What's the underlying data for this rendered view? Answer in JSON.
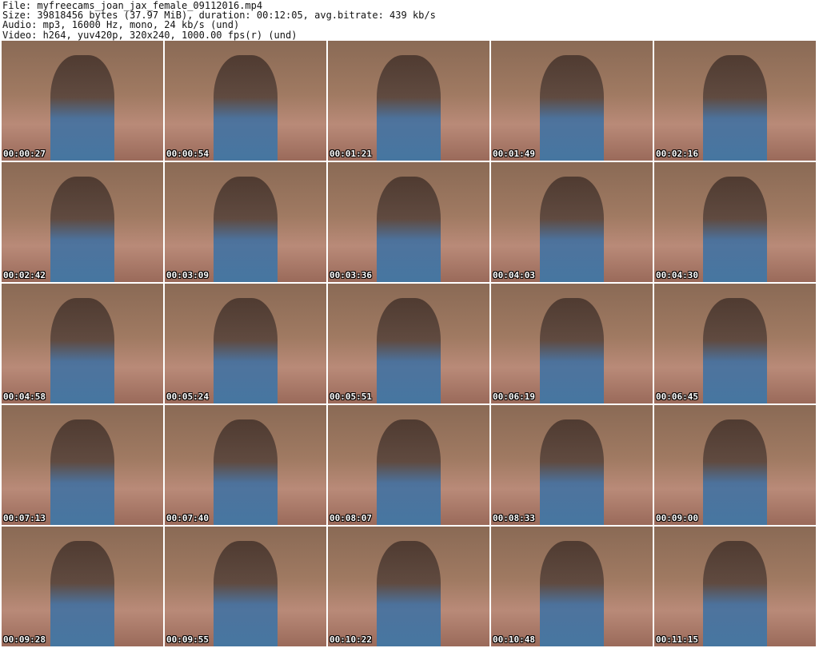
{
  "header": {
    "file_line": "File: myfreecams_joan_jax_female_09112016.mp4",
    "size_line": "Size: 39818456 bytes (37.97 MiB), duration: 00:12:05, avg.bitrate: 439 kb/s",
    "audio_line": "Audio: mp3, 16000 Hz, mono, 24 kb/s (und)",
    "video_line": "Video: h264, yuv420p, 320x240, 1000.00 fps(r) (und)"
  },
  "thumbnails": [
    {
      "timestamp": "00:00:27"
    },
    {
      "timestamp": "00:00:54"
    },
    {
      "timestamp": "00:01:21"
    },
    {
      "timestamp": "00:01:49"
    },
    {
      "timestamp": "00:02:16"
    },
    {
      "timestamp": "00:02:42"
    },
    {
      "timestamp": "00:03:09"
    },
    {
      "timestamp": "00:03:36"
    },
    {
      "timestamp": "00:04:03"
    },
    {
      "timestamp": "00:04:30"
    },
    {
      "timestamp": "00:04:58"
    },
    {
      "timestamp": "00:05:24"
    },
    {
      "timestamp": "00:05:51"
    },
    {
      "timestamp": "00:06:19"
    },
    {
      "timestamp": "00:06:45"
    },
    {
      "timestamp": "00:07:13"
    },
    {
      "timestamp": "00:07:40"
    },
    {
      "timestamp": "00:08:07"
    },
    {
      "timestamp": "00:08:33"
    },
    {
      "timestamp": "00:09:00"
    },
    {
      "timestamp": "00:09:28"
    },
    {
      "timestamp": "00:09:55"
    },
    {
      "timestamp": "00:10:22"
    },
    {
      "timestamp": "00:10:48"
    },
    {
      "timestamp": "00:11:15"
    }
  ]
}
